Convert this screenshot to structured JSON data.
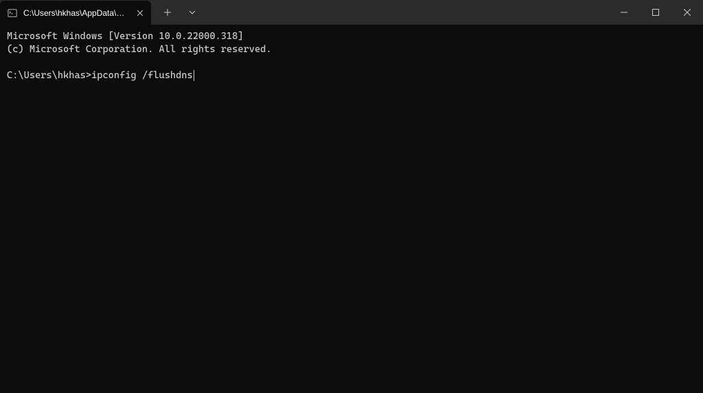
{
  "tab": {
    "title": "C:\\Users\\hkhas\\AppData\\Roami"
  },
  "terminal": {
    "line1": "Microsoft Windows [Version 10.0.22000.318]",
    "line2": "(c) Microsoft Corporation. All rights reserved.",
    "prompt": "C:\\Users\\hkhas>",
    "command": "ipconfig /flushdns"
  }
}
